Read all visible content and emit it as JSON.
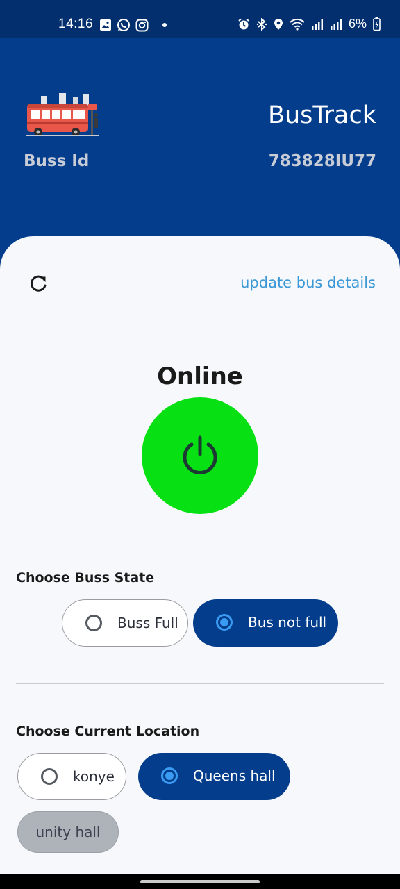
{
  "status_bar": {
    "time": "14:16",
    "battery": "6%",
    "left_icons": [
      "gallery-icon",
      "whatsapp-icon",
      "instagram-icon",
      "notification-dot"
    ],
    "right_icons": [
      "alarm-icon",
      "bluetooth-icon",
      "location-icon",
      "wifi-icon",
      "signal-icon",
      "signal-icon",
      "battery-icon"
    ]
  },
  "header": {
    "app_title": "BusTrack",
    "bus_id_label": "Buss Id",
    "bus_id_value": "783828IU77",
    "background_color": "#033d8c"
  },
  "actions": {
    "refresh_icon": "refresh-icon",
    "update_link": "update bus details"
  },
  "power": {
    "status_label": "Online",
    "button_color": "#07e012",
    "icon": "power-icon"
  },
  "bus_state": {
    "title": "Choose Buss State",
    "options": [
      {
        "label": "Buss Full",
        "selected": false
      },
      {
        "label": "Bus not full",
        "selected": true
      }
    ]
  },
  "location": {
    "title": "Choose Current Location",
    "options": [
      {
        "label": "konye",
        "selected": false
      },
      {
        "label": "Queens hall",
        "selected": true
      },
      {
        "label": "unity hall",
        "selected": false,
        "disabled": true
      }
    ]
  },
  "colors": {
    "accent": "#033d8c",
    "radio_selected": "#3a9bf2",
    "link": "#3b98d6"
  }
}
